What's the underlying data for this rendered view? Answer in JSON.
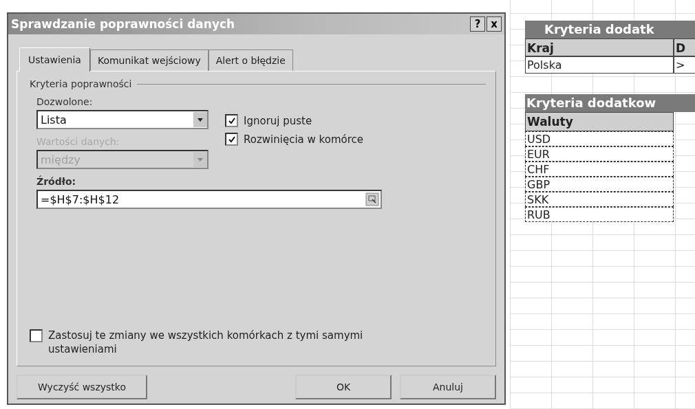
{
  "dialog": {
    "title": "Sprawdzanie poprawności danych",
    "help_button": "?",
    "close_button": "x",
    "tabs": [
      {
        "label": "Ustawienia",
        "selected": true
      },
      {
        "label": "Komunikat wejściowy",
        "selected": false
      },
      {
        "label": "Alert o błędzie",
        "selected": false
      }
    ],
    "group_title": "Kryteria poprawności",
    "allow": {
      "label": "Dozwolone:",
      "value": "Lista",
      "disabled": false
    },
    "data": {
      "label": "Wartości danych:",
      "value": "między",
      "disabled": true
    },
    "checkboxes": [
      {
        "label": "Ignoruj puste",
        "checked": true
      },
      {
        "label": "Rozwinięcia w komórce",
        "checked": true
      }
    ],
    "source": {
      "label": "Źródło:",
      "value": "=$H$7:$H$12"
    },
    "apply_all": {
      "label": "Zastosuj te zmiany we wszystkich komórkach z tymi samymi ustawieniami",
      "checked": false
    },
    "buttons": {
      "clear": "Wyczyść wszystko",
      "ok": "OK",
      "cancel": "Anuluj"
    }
  },
  "sheet": {
    "table_1": {
      "title": "Kryteria dodatk",
      "columns": [
        "Kraj",
        "D"
      ],
      "rows": [
        [
          "Polska",
          ">"
        ]
      ]
    },
    "table_2": {
      "title": "Kryteria dodatkow",
      "header": "Waluty",
      "rows": [
        "USD",
        "EUR",
        "CHF",
        "GBP",
        "SKK",
        "RUB"
      ]
    }
  }
}
